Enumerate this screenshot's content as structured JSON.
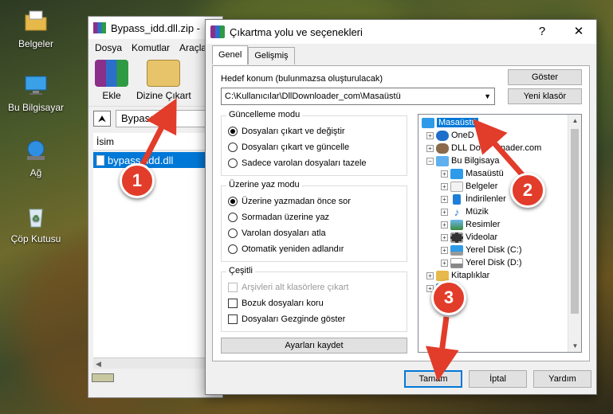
{
  "desktop": {
    "icons": [
      {
        "label": "Belgeler",
        "icon": "folder-icon"
      },
      {
        "label": "Bu Bilgisayar",
        "icon": "computer-icon"
      },
      {
        "label": "Ağ",
        "icon": "network-icon"
      },
      {
        "label": "Çöp Kutusu",
        "icon": "recycle-bin-icon"
      }
    ]
  },
  "winrar": {
    "title": "Bypass_idd.dll.zip -",
    "menu": [
      "Dosya",
      "Komutlar",
      "Araçla"
    ],
    "toolbar": {
      "add": "Ekle",
      "extract_to": "Dizine Çıkart"
    },
    "path": "Bypass_id",
    "column_name": "İsim",
    "file": "bypass_idd.dll"
  },
  "dialog": {
    "title": "Çıkartma yolu ve seçenekleri",
    "tabs": [
      "Genel",
      "Gelişmiş"
    ],
    "target_label": "Hedef konum (bulunmazsa oluşturulacak)",
    "target_value": "C:\\Kullanıcılar\\DllDownloader_com\\Masaüstü",
    "show_button": "Göster",
    "new_folder_button": "Yeni klasör",
    "update_mode": {
      "title": "Güncelleme modu",
      "options": [
        "Dosyaları çıkart ve değiştir",
        "Dosyaları çıkart ve güncelle",
        "Sadece varolan dosyaları tazele"
      ],
      "selected": 0
    },
    "overwrite_mode": {
      "title": "Üzerine yaz modu",
      "options": [
        "Üzerine yazmadan önce sor",
        "Sormadan üzerine yaz",
        "Varolan dosyaları atla",
        "Otomatik yeniden adlandır"
      ],
      "selected": 0
    },
    "misc": {
      "title": "Çeşitli",
      "options": [
        "Arşivleri alt klasörlere çıkart",
        "Bozuk dosyaları koru",
        "Dosyaları Gezginde göster"
      ]
    },
    "save_settings": "Ayarları kaydet",
    "tree": [
      "Masaüstü",
      "OneD",
      "DLL Do",
      "nader.com",
      "Bu Bilgisaya",
      "Masaüstü",
      "Belgeler",
      "İndirilenler",
      "Müzik",
      "Resimler",
      "Videolar",
      "Yerel Disk (C:)",
      "Yerel Disk (D:)",
      "Kitaplıklar",
      "ğ"
    ],
    "ok": "Tamam",
    "cancel": "İptal",
    "help": "Yardım"
  },
  "annotations": [
    "1",
    "2",
    "3"
  ],
  "colors": {
    "selection": "#0078d7",
    "badge": "#e23c2a"
  }
}
